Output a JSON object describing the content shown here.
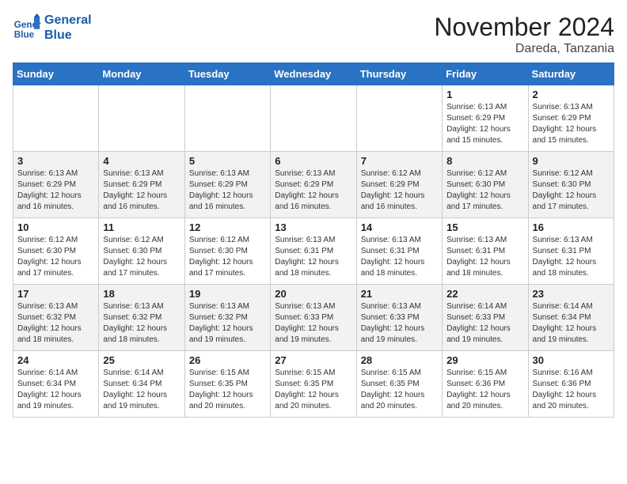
{
  "header": {
    "logo_line1": "General",
    "logo_line2": "Blue",
    "month_title": "November 2024",
    "location": "Dareda, Tanzania"
  },
  "days_of_week": [
    "Sunday",
    "Monday",
    "Tuesday",
    "Wednesday",
    "Thursday",
    "Friday",
    "Saturday"
  ],
  "weeks": [
    [
      {
        "day": "",
        "info": ""
      },
      {
        "day": "",
        "info": ""
      },
      {
        "day": "",
        "info": ""
      },
      {
        "day": "",
        "info": ""
      },
      {
        "day": "",
        "info": ""
      },
      {
        "day": "1",
        "info": "Sunrise: 6:13 AM\nSunset: 6:29 PM\nDaylight: 12 hours\nand 15 minutes."
      },
      {
        "day": "2",
        "info": "Sunrise: 6:13 AM\nSunset: 6:29 PM\nDaylight: 12 hours\nand 15 minutes."
      }
    ],
    [
      {
        "day": "3",
        "info": "Sunrise: 6:13 AM\nSunset: 6:29 PM\nDaylight: 12 hours\nand 16 minutes."
      },
      {
        "day": "4",
        "info": "Sunrise: 6:13 AM\nSunset: 6:29 PM\nDaylight: 12 hours\nand 16 minutes."
      },
      {
        "day": "5",
        "info": "Sunrise: 6:13 AM\nSunset: 6:29 PM\nDaylight: 12 hours\nand 16 minutes."
      },
      {
        "day": "6",
        "info": "Sunrise: 6:13 AM\nSunset: 6:29 PM\nDaylight: 12 hours\nand 16 minutes."
      },
      {
        "day": "7",
        "info": "Sunrise: 6:12 AM\nSunset: 6:29 PM\nDaylight: 12 hours\nand 16 minutes."
      },
      {
        "day": "8",
        "info": "Sunrise: 6:12 AM\nSunset: 6:30 PM\nDaylight: 12 hours\nand 17 minutes."
      },
      {
        "day": "9",
        "info": "Sunrise: 6:12 AM\nSunset: 6:30 PM\nDaylight: 12 hours\nand 17 minutes."
      }
    ],
    [
      {
        "day": "10",
        "info": "Sunrise: 6:12 AM\nSunset: 6:30 PM\nDaylight: 12 hours\nand 17 minutes."
      },
      {
        "day": "11",
        "info": "Sunrise: 6:12 AM\nSunset: 6:30 PM\nDaylight: 12 hours\nand 17 minutes."
      },
      {
        "day": "12",
        "info": "Sunrise: 6:12 AM\nSunset: 6:30 PM\nDaylight: 12 hours\nand 17 minutes."
      },
      {
        "day": "13",
        "info": "Sunrise: 6:13 AM\nSunset: 6:31 PM\nDaylight: 12 hours\nand 18 minutes."
      },
      {
        "day": "14",
        "info": "Sunrise: 6:13 AM\nSunset: 6:31 PM\nDaylight: 12 hours\nand 18 minutes."
      },
      {
        "day": "15",
        "info": "Sunrise: 6:13 AM\nSunset: 6:31 PM\nDaylight: 12 hours\nand 18 minutes."
      },
      {
        "day": "16",
        "info": "Sunrise: 6:13 AM\nSunset: 6:31 PM\nDaylight: 12 hours\nand 18 minutes."
      }
    ],
    [
      {
        "day": "17",
        "info": "Sunrise: 6:13 AM\nSunset: 6:32 PM\nDaylight: 12 hours\nand 18 minutes."
      },
      {
        "day": "18",
        "info": "Sunrise: 6:13 AM\nSunset: 6:32 PM\nDaylight: 12 hours\nand 18 minutes."
      },
      {
        "day": "19",
        "info": "Sunrise: 6:13 AM\nSunset: 6:32 PM\nDaylight: 12 hours\nand 19 minutes."
      },
      {
        "day": "20",
        "info": "Sunrise: 6:13 AM\nSunset: 6:33 PM\nDaylight: 12 hours\nand 19 minutes."
      },
      {
        "day": "21",
        "info": "Sunrise: 6:13 AM\nSunset: 6:33 PM\nDaylight: 12 hours\nand 19 minutes."
      },
      {
        "day": "22",
        "info": "Sunrise: 6:14 AM\nSunset: 6:33 PM\nDaylight: 12 hours\nand 19 minutes."
      },
      {
        "day": "23",
        "info": "Sunrise: 6:14 AM\nSunset: 6:34 PM\nDaylight: 12 hours\nand 19 minutes."
      }
    ],
    [
      {
        "day": "24",
        "info": "Sunrise: 6:14 AM\nSunset: 6:34 PM\nDaylight: 12 hours\nand 19 minutes."
      },
      {
        "day": "25",
        "info": "Sunrise: 6:14 AM\nSunset: 6:34 PM\nDaylight: 12 hours\nand 19 minutes."
      },
      {
        "day": "26",
        "info": "Sunrise: 6:15 AM\nSunset: 6:35 PM\nDaylight: 12 hours\nand 20 minutes."
      },
      {
        "day": "27",
        "info": "Sunrise: 6:15 AM\nSunset: 6:35 PM\nDaylight: 12 hours\nand 20 minutes."
      },
      {
        "day": "28",
        "info": "Sunrise: 6:15 AM\nSunset: 6:35 PM\nDaylight: 12 hours\nand 20 minutes."
      },
      {
        "day": "29",
        "info": "Sunrise: 6:15 AM\nSunset: 6:36 PM\nDaylight: 12 hours\nand 20 minutes."
      },
      {
        "day": "30",
        "info": "Sunrise: 6:16 AM\nSunset: 6:36 PM\nDaylight: 12 hours\nand 20 minutes."
      }
    ]
  ]
}
